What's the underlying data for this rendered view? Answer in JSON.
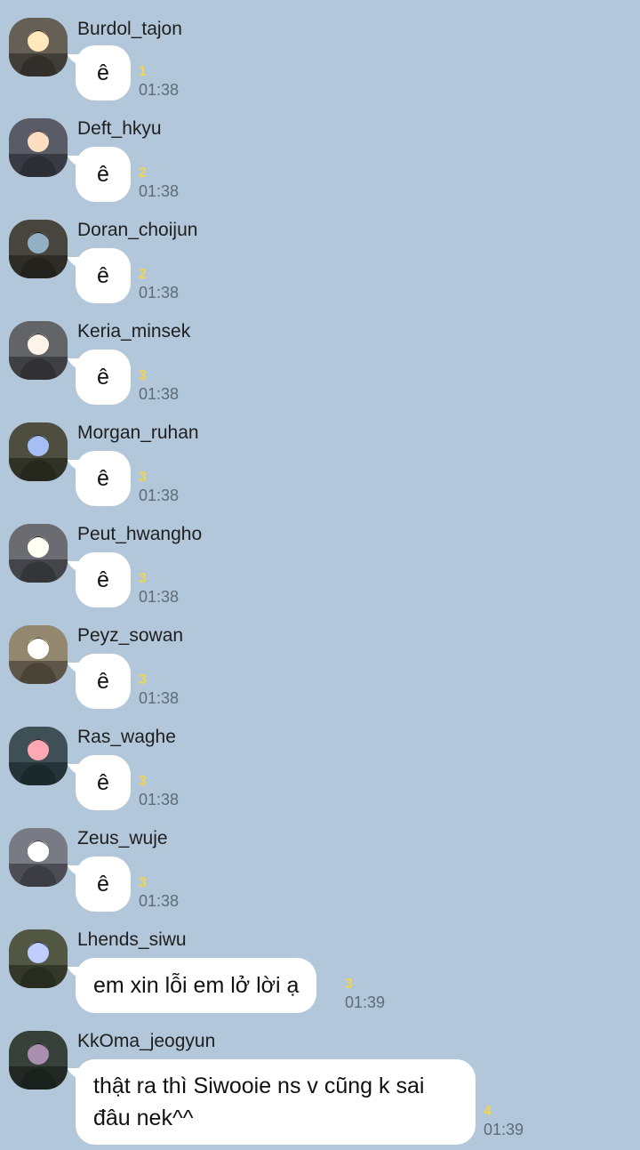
{
  "colors": {
    "background": "#b2c7da",
    "bubble": "#ffffff",
    "unread": "#f2d54b",
    "time": "#5f6b77"
  },
  "messages": [
    {
      "sender": "Burdol_tajon",
      "text": "ê",
      "unread": "1",
      "time": "01:38",
      "avatar": "avatar-photo"
    },
    {
      "sender": "Deft_hkyu",
      "text": "ê",
      "unread": "2",
      "time": "01:38",
      "avatar": "avatar-photo"
    },
    {
      "sender": "Doran_choijun",
      "text": "ê",
      "unread": "2",
      "time": "01:38",
      "avatar": "avatar-photo"
    },
    {
      "sender": "Keria_minsek",
      "text": "ê",
      "unread": "3",
      "time": "01:38",
      "avatar": "avatar-photo"
    },
    {
      "sender": "Morgan_ruhan",
      "text": "ê",
      "unread": "3",
      "time": "01:38",
      "avatar": "avatar-photo"
    },
    {
      "sender": "Peut_hwangho",
      "text": "ê",
      "unread": "3",
      "time": "01:38",
      "avatar": "avatar-photo"
    },
    {
      "sender": "Peyz_sowan",
      "text": "ê",
      "unread": "3",
      "time": "01:38",
      "avatar": "avatar-photo"
    },
    {
      "sender": "Ras_waghe",
      "text": "ê",
      "unread": "3",
      "time": "01:38",
      "avatar": "avatar-photo"
    },
    {
      "sender": "Zeus_wuje",
      "text": "ê",
      "unread": "3",
      "time": "01:38",
      "avatar": "avatar-photo"
    },
    {
      "sender": "Lhends_siwu",
      "text": "em xin lỗi em lở lời ạ",
      "unread": "3",
      "time": "01:39",
      "avatar": "avatar-photo"
    },
    {
      "sender": "KkOma_jeogyun",
      "text_line1": "thật ra thì Siwooie ns v cũng k sai",
      "text_line2": "đâu nek^^",
      "unread": "4",
      "time": "01:39",
      "avatar": "avatar-photo"
    }
  ]
}
